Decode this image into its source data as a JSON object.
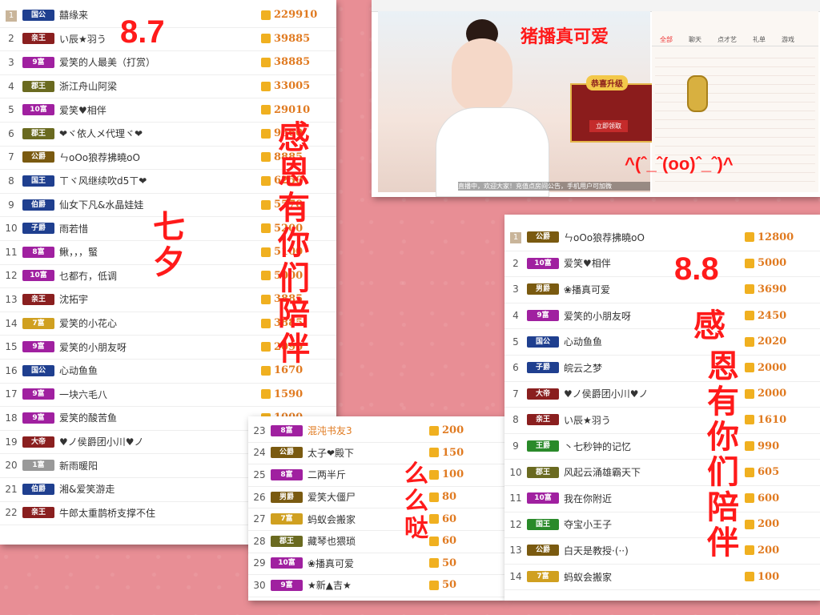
{
  "labels": {
    "d87": "8.7",
    "d88": "8.8",
    "qixi": "七夕",
    "thanks1": "感恩有你们陪伴",
    "thanks2_a": "感",
    "thanks2_b": "恩有你们陪伴",
    "kiss": "么么哒",
    "cute": "猪播真可爱",
    "emoticon": "^(ˆ_ˆ(oo)ˆ_ˆ)^"
  },
  "video": {
    "upgrade_title": "恭喜升级",
    "upgrade_btn": "立即领取",
    "marquee": "直播中，欢迎大家！充值点房间公告，手机用户可加微",
    "tabs": [
      "全部",
      "聊天",
      "点才艺",
      "礼单",
      "游戏"
    ]
  },
  "list1": [
    {
      "rank": "1",
      "badge": "国公",
      "color": "#1f3f8f",
      "name": "囍缘来",
      "value": "229910"
    },
    {
      "rank": "2",
      "badge": "亲王",
      "color": "#8a1f1f",
      "name": "い辰★羽う",
      "value": "39885"
    },
    {
      "rank": "3",
      "badge": "9富",
      "color": "#a020a0",
      "name": "爱笑的人最美（打赏）",
      "value": "38885"
    },
    {
      "rank": "4",
      "badge": "郡王",
      "color": "#6a6a20",
      "name": "浙江舟山阿梁",
      "value": "33005"
    },
    {
      "rank": "5",
      "badge": "10富",
      "color": "#a020a0",
      "name": "爱笑♥相伴",
      "value": "29010"
    },
    {
      "rank": "6",
      "badge": "郡王",
      "color": "#6a6a20",
      "name": "❤ヾ依人メ代理ヾ❤",
      "value": "9660"
    },
    {
      "rank": "7",
      "badge": "公爵",
      "color": "#7a5a10",
      "name": "ㄣoOo狼荐拂曉oO",
      "value": "8885"
    },
    {
      "rank": "8",
      "badge": "国王",
      "color": "#1f3f8f",
      "name": "ㄒヾ风继续吹d5ㄒ❤",
      "value": "6250"
    },
    {
      "rank": "9",
      "badge": "伯爵",
      "color": "#1f3f8f",
      "name": "仙女下凡&水晶娃娃",
      "value": "5570"
    },
    {
      "rank": "10",
      "badge": "子爵",
      "color": "#1f3f8f",
      "name": "雨若惜",
      "value": "5200"
    },
    {
      "rank": "11",
      "badge": "8富",
      "color": "#a020a0",
      "name": "鳅，，，蜸",
      "value": "5100"
    },
    {
      "rank": "12",
      "badge": "10富",
      "color": "#a020a0",
      "name": "乜都冇，低调",
      "value": "5000"
    },
    {
      "rank": "13",
      "badge": "亲王",
      "color": "#8a1f1f",
      "name": "沈拓宇",
      "value": "3885"
    },
    {
      "rank": "14",
      "badge": "7富",
      "color": "#d0a020",
      "name": "爱笑的小花心",
      "value": "3885"
    },
    {
      "rank": "15",
      "badge": "9富",
      "color": "#a020a0",
      "name": "爱笑的小朋友呀",
      "value": "2090"
    },
    {
      "rank": "16",
      "badge": "国公",
      "color": "#1f3f8f",
      "name": "心动鱼鱼",
      "value": "1670"
    },
    {
      "rank": "17",
      "badge": "9富",
      "color": "#a020a0",
      "name": "一块六毛八",
      "value": "1590"
    },
    {
      "rank": "18",
      "badge": "9富",
      "color": "#a020a0",
      "name": "爱笑的酸苦鱼",
      "value": "1000"
    },
    {
      "rank": "19",
      "badge": "大帝",
      "color": "#8a1f1f",
      "name": "♥ノ侯爵团小川♥ノ",
      "value": "1000"
    },
    {
      "rank": "20",
      "badge": "1富",
      "color": "#999999",
      "name": "新雨暖阳",
      "value": "500"
    },
    {
      "rank": "21",
      "badge": "伯爵",
      "color": "#1f3f8f",
      "name": "湘&爱笑游走",
      "value": "310"
    },
    {
      "rank": "22",
      "badge": "亲王",
      "color": "#8a1f1f",
      "name": "牛郎太重鹊桥支撑不住",
      "value": "250"
    }
  ],
  "list2": [
    {
      "rank": "23",
      "badge": "8富",
      "color": "#a020a0",
      "name": "混沌书友3",
      "value": "200",
      "hl": true
    },
    {
      "rank": "24",
      "badge": "公爵",
      "color": "#7a5a10",
      "name": "太子❤殿下",
      "value": "150"
    },
    {
      "rank": "25",
      "badge": "8富",
      "color": "#a020a0",
      "name": "二两半斤",
      "value": "100"
    },
    {
      "rank": "26",
      "badge": "男爵",
      "color": "#7a5a10",
      "name": "爱笑大僵尸",
      "value": "80"
    },
    {
      "rank": "27",
      "badge": "7富",
      "color": "#d0a020",
      "name": "蚂蚁会搬家",
      "value": "60"
    },
    {
      "rank": "28",
      "badge": "郡王",
      "color": "#6a6a20",
      "name": "藏琴也猥琐",
      "value": "60"
    },
    {
      "rank": "29",
      "badge": "10富",
      "color": "#a020a0",
      "name": "❀播真可爱",
      "value": "50"
    },
    {
      "rank": "30",
      "badge": "9富",
      "color": "#a020a0",
      "name": "★新▲吉★",
      "value": "50"
    }
  ],
  "list3": [
    {
      "rank": "1",
      "badge": "公爵",
      "color": "#7a5a10",
      "name": "ㄣoOo狼荐拂曉oO",
      "value": "12800"
    },
    {
      "rank": "2",
      "badge": "10富",
      "color": "#a020a0",
      "name": "爱笑♥相伴",
      "value": "5000"
    },
    {
      "rank": "3",
      "badge": "男爵",
      "color": "#7a5a10",
      "name": "❀播真可爱",
      "value": "3690"
    },
    {
      "rank": "4",
      "badge": "9富",
      "color": "#a020a0",
      "name": "爱笑的小朋友呀",
      "value": "2450"
    },
    {
      "rank": "5",
      "badge": "国公",
      "color": "#1f3f8f",
      "name": "心动鱼鱼",
      "value": "2020"
    },
    {
      "rank": "6",
      "badge": "子爵",
      "color": "#1f3f8f",
      "name": "皖云之梦",
      "value": "2000"
    },
    {
      "rank": "7",
      "badge": "大帝",
      "color": "#8a1f1f",
      "name": "♥ノ侯爵团小川♥ノ",
      "value": "2000"
    },
    {
      "rank": "8",
      "badge": "亲王",
      "color": "#8a1f1f",
      "name": "い辰★羽う",
      "value": "1610"
    },
    {
      "rank": "9",
      "badge": "王爵",
      "color": "#2a8a2a",
      "name": "丶七秒钟的记忆",
      "value": "990"
    },
    {
      "rank": "10",
      "badge": "郡王",
      "color": "#6a6a20",
      "name": "风起云涌雄霸天下",
      "value": "605"
    },
    {
      "rank": "11",
      "badge": "10富",
      "color": "#a020a0",
      "name": "我在你附近",
      "value": "600"
    },
    {
      "rank": "12",
      "badge": "国王",
      "color": "#2a8a2a",
      "name": "夺宝小王子",
      "value": "200"
    },
    {
      "rank": "13",
      "badge": "公爵",
      "color": "#7a5a10",
      "name": "白天是教授·(··)",
      "value": "200"
    },
    {
      "rank": "14",
      "badge": "7富",
      "color": "#d0a020",
      "name": "蚂蚁会搬家",
      "value": "100"
    }
  ]
}
